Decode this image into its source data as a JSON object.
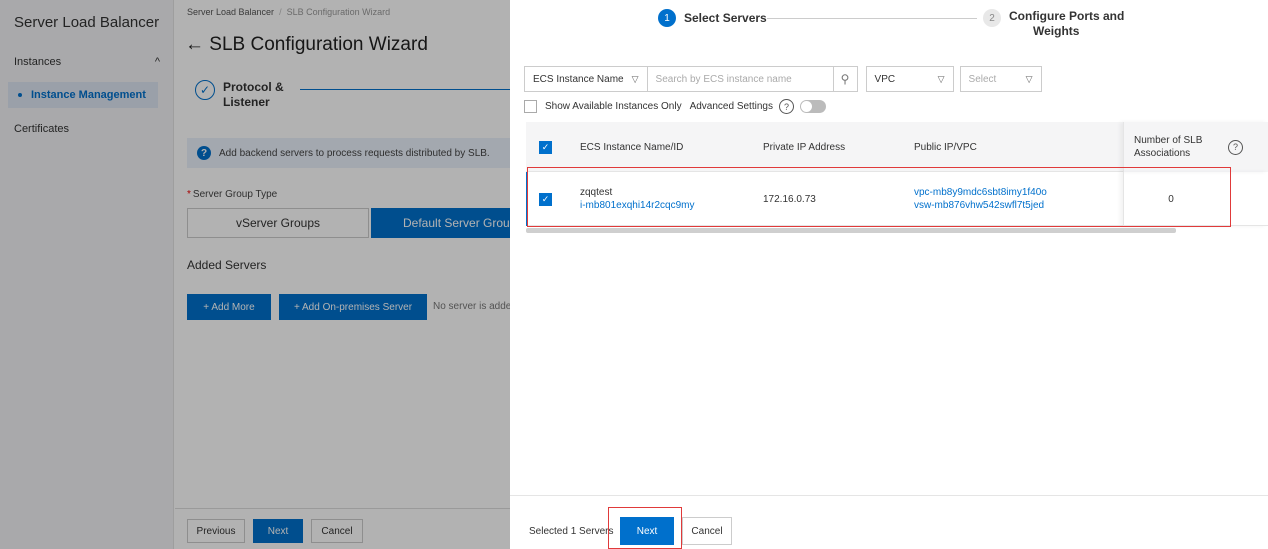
{
  "sidebar": {
    "title": "Server Load Balancer",
    "section_label": "Instances",
    "section_chevron": "^",
    "active_item": "Instance Management",
    "item_certificates": "Certificates"
  },
  "main": {
    "breadcrumb_root": "Server Load Balancer",
    "breadcrumb_sep": "/",
    "breadcrumb_current": "SLB Configuration Wizard",
    "title": "← SLB Configuration Wizard",
    "step1_label_line1": "Protocol &",
    "step1_label_line2": "Listener",
    "info_text": "Add backend servers to process requests distributed by SLB.",
    "server_group_type_label": "Server Group Type",
    "required_mark": "*",
    "vserver_groups": "vServer Groups",
    "default_server_group": "Default Server Grou",
    "added_servers": "Added Servers",
    "add_more": "+ Add More",
    "add_onprem": "+ Add On-premises Server",
    "no_server_text": "No server is adde",
    "footer_previous": "Previous",
    "footer_next": "Next",
    "footer_cancel": "Cancel"
  },
  "drawer": {
    "step1_num": "1",
    "step1_label": "Select Servers",
    "step2_num": "2",
    "step2_label_line1": "Configure Ports and",
    "step2_label_line2": "Weights",
    "filter_type": "ECS Instance Name",
    "search_placeholder": "Search by ECS instance name",
    "vpc_label": "VPC",
    "select_placeholder": "Select",
    "show_available": "Show Available Instances Only",
    "advanced_settings": "Advanced Settings",
    "help_glyph": "?",
    "columns": {
      "name": "ECS Instance Name/ID",
      "private_ip": "Private IP Address",
      "public_ip": "Public IP/VPC",
      "slb_line1": "Number of SLB",
      "slb_line2": "Associations"
    },
    "rows": [
      {
        "name": "zqqtest",
        "id": "i-mb801exqhi14r2cqc9my",
        "private_ip": "172.16.0.73",
        "vpc": "vpc-mb8y9mdc6sbt8imy1f40o",
        "vsw": "vsw-mb876vhw542swfl7t5jed",
        "slb_count": "0"
      }
    ],
    "selected_text": "Selected 1 Servers",
    "next": "Next",
    "cancel": "Cancel"
  },
  "colors": {
    "primary": "#0070cc",
    "highlight": "#e03a3a"
  }
}
